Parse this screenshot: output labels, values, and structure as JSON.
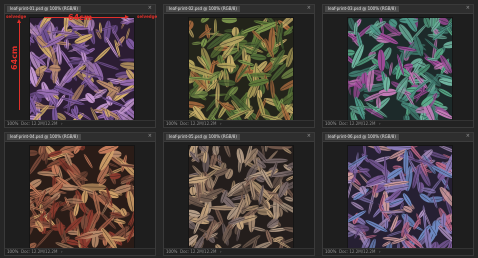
{
  "annotations": {
    "width_label": "64cm",
    "height_label": "64cm",
    "selvedge_left": "selvedge",
    "selvedge_right": "selvedge",
    "color": "#e0302a"
  },
  "panels": [
    {
      "tab_label": "leaf-print-01.psd @ 100% (RGB/8)",
      "zoom": "100%",
      "doc_info": "Doc: 12.2M/12.2M",
      "palette": {
        "bg": "#2c1d33",
        "leaves": [
          "#9b6fb5",
          "#c79ad4",
          "#7d5aa0",
          "#b98a6a",
          "#d9b36b",
          "#6e4f8f"
        ]
      }
    },
    {
      "tab_label": "leaf-print-02.psd @ 100% (RGB/8)",
      "zoom": "100%",
      "doc_info": "Doc: 12.2M/12.2M",
      "palette": {
        "bg": "#23241a",
        "leaves": [
          "#7f9a4e",
          "#b3a35c",
          "#5f7a3a",
          "#a86a3e",
          "#c9b06b",
          "#4f6a37"
        ]
      }
    },
    {
      "tab_label": "leaf-print-03.psd @ 100% (RGB/8)",
      "zoom": "100%",
      "doc_info": "Doc: 12.2M/12.2M",
      "palette": {
        "bg": "#1d2a2a",
        "leaves": [
          "#4f9a8a",
          "#6fb5a0",
          "#a04a9a",
          "#3f7a6e",
          "#c47ab8",
          "#5ab08c"
        ]
      }
    },
    {
      "tab_label": "leaf-print-04.psd @ 100% (RGB/8)",
      "zoom": "100%",
      "doc_info": "Doc: 12.2M/12.2M",
      "palette": {
        "bg": "#2a1c17",
        "leaves": [
          "#a05a44",
          "#c27a5a",
          "#7a4a3a",
          "#b98a6a",
          "#d4a36b",
          "#8a3a2e"
        ]
      }
    },
    {
      "tab_label": "leaf-print-05.psd @ 100% (RGB/8)",
      "zoom": "100%",
      "doc_info": "Doc: 12.2M/12.2M",
      "palette": {
        "bg": "#241e1c",
        "leaves": [
          "#8a6a5a",
          "#a58a72",
          "#6e5a4e",
          "#b8a08a",
          "#7a6a6a",
          "#c4a47e"
        ]
      }
    },
    {
      "tab_label": "leaf-print-06.psd @ 100% (RGB/8)",
      "zoom": "100%",
      "doc_info": "Doc: 12.2M/12.2M",
      "palette": {
        "bg": "#262033",
        "leaves": [
          "#8a7ab8",
          "#b094c4",
          "#c46a8a",
          "#6e8ac4",
          "#d4a0a0",
          "#7a5a9a"
        ]
      }
    }
  ]
}
